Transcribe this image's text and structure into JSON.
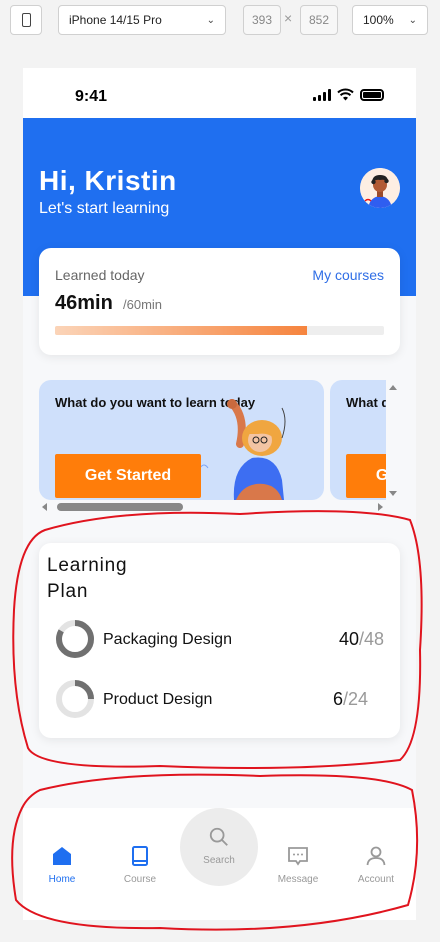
{
  "devtools": {
    "device": "iPhone 14/15 Pro",
    "width": "393",
    "height": "852",
    "zoom": "100%"
  },
  "status": {
    "time": "9:41"
  },
  "header": {
    "greeting": "Hi, Kristin",
    "subtitle": "Let's start learning"
  },
  "progress": {
    "label": "Learned today",
    "link": "My courses",
    "value": "46min",
    "goal": "/60min",
    "fraction": 0.7667,
    "bar_color": "#f6843e"
  },
  "promos": [
    {
      "title": "What do you want to learn today",
      "button": "Get Started"
    },
    {
      "title": "What do you want to learn today",
      "button": "Get Started"
    }
  ],
  "plan": {
    "title": "Learning Plan",
    "items": [
      {
        "name": "Packaging Design",
        "done": "40",
        "total": "/48"
      },
      {
        "name": "Product Design",
        "done": "6",
        "total": "/24"
      }
    ]
  },
  "nav": {
    "home": "Home",
    "course": "Course",
    "search": "Search",
    "message": "Message",
    "account": "Account",
    "active_color": "#1f6ff0"
  },
  "colors": {
    "primary": "#1f6ff0",
    "accent": "#ff7d0a",
    "annotation": "#e0141e"
  }
}
